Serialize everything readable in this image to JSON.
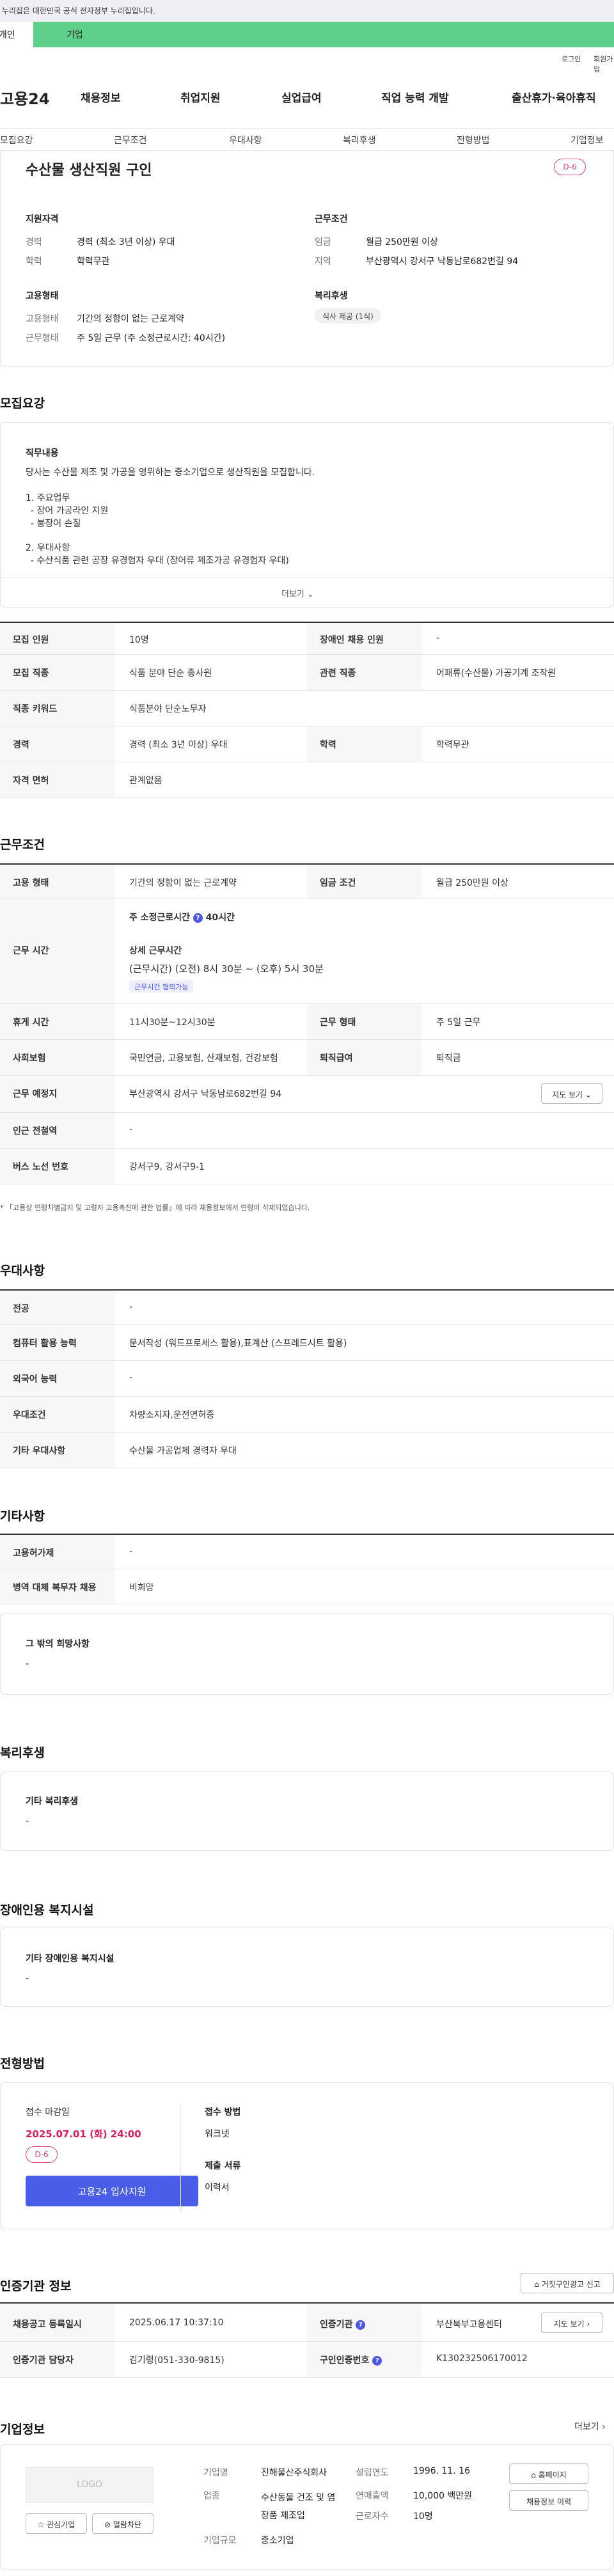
{
  "gov_banner": "이 누리집은 대한민국 공식 전자정부 누리집입니다.",
  "user_tabs": {
    "individual": "개인",
    "business": "기업"
  },
  "util_links": {
    "login": "로그인",
    "join": "회원가입"
  },
  "logo": "고용24",
  "gnb": [
    "채용정보",
    "취업지원",
    "실업급여",
    "직업 능력 개발",
    "출산휴가·육아휴직"
  ],
  "subnav": [
    "모집요강",
    "근무조건",
    "우대사항",
    "복리후생",
    "전형방법",
    "기업정보"
  ],
  "summary": {
    "title": "수산물 생산직원 구인",
    "dday": "D-6",
    "qualification": {
      "heading": "지원자격",
      "career_label": "경력",
      "career_value": "경력 (최소 3년 이상) 우대",
      "edu_label": "학력",
      "edu_value": "학력무관"
    },
    "condition": {
      "heading": "근무조건",
      "wage_label": "임금",
      "wage_value": "월급 250만원 이상",
      "region_label": "지역",
      "region_value": "부산광역시 강서구 낙동남로682번길 94"
    },
    "employment": {
      "heading": "고용형태",
      "type_label": "고용형태",
      "type_value": "기간의 정함이 없는 근로계약",
      "work_label": "근무형태",
      "work_value": "주 5일 근무 (주 소정근로시간: 40시간)"
    },
    "welfare": {
      "heading": "복리후생",
      "chip": "식사 제공 (1식)"
    }
  },
  "recruit": {
    "heading": "모집요강",
    "duty_heading": "직무내용",
    "lines": [
      "당사는 수산물 제조 및 가공을 영위하는 중소기업으로 생산직원을 모집합니다.",
      "1. 주요업무",
      "   - 장어 가공라인 지원",
      "   - 붕장어 손질",
      "2. 우대사항",
      "   - 수산식품 관련 공장 유경험자 우대 (장어류 제조가공 유경험자 우대)"
    ],
    "more": "더보기",
    "table": [
      {
        "l1": "모집 인원",
        "v1": "10명",
        "l2": "장애인 채용 인원",
        "v2": "-"
      },
      {
        "l1": "모집 직종",
        "v1": "식품 분야 단순 종사원",
        "l2": "관련 직종",
        "v2": "어패류(수산물) 가공기계 조작원"
      },
      {
        "l1": "직종 키워드",
        "v1": "식품분야 단순노무자",
        "l2": "",
        "v2": ""
      },
      {
        "l1": "경력",
        "v1": "경력 (최소 3년 이상) 우대",
        "l2": "학력",
        "v2": "학력무관"
      },
      {
        "l1": "자격 면허",
        "v1": "관계없음",
        "l2": "",
        "v2": ""
      }
    ]
  },
  "work": {
    "heading": "근무조건",
    "type_label": "고용 형태",
    "type_value": "기간의 정함이 없는 근로계약",
    "wage_label": "임금 조건",
    "wage_value": "월급 250만원 이상",
    "time_label": "근무 시간",
    "weekly_label": "주 소정근로시간",
    "weekly_value": "40시간",
    "detail_label": "상세 근무시간",
    "detail_value": "(근무시간) (오전) 8시 30분 ~ (오후) 5시 30분",
    "flex_chip": "근무시간 협의가능",
    "rest_label": "휴게 시간",
    "rest_value": "11시30분~12시30분",
    "form_label": "근무 형태",
    "form_value": "주 5일 근무",
    "insurance_label": "사회보험",
    "insurance_value": "국민연금, 고용보험, 산재보험, 건강보험",
    "severance_label": "퇴직급여",
    "severance_value": "퇴직금",
    "place_label": "근무 예정지",
    "place_value": "부산광역시 강서구 낙동남로682번길 94",
    "map_btn": "지도 보기",
    "subway_label": "인근 전철역",
    "subway_value": "-",
    "bus_label": "버스 노선 번호",
    "bus_value": "강서구9, 강서구9-1",
    "note": "「고용상 연령차별금지 및 고령자 고용촉진에 관한 법률」에 따라 채용정보에서 연령이 삭제되었습니다."
  },
  "preference": {
    "heading": "우대사항",
    "rows": [
      {
        "label": "전공",
        "value": "-"
      },
      {
        "label": "컴퓨터 활용 능력",
        "value": "문서작성 (워드프로세스 활용),표계산 (스프레드시트 활용)"
      },
      {
        "label": "외국어 능력",
        "value": "-"
      },
      {
        "label": "우대조건",
        "value": "차량소지자,운전면허증"
      },
      {
        "label": "기타 우대사항",
        "value": "수산물 가공업체 경력자 우대"
      }
    ]
  },
  "etc": {
    "heading": "기타사항",
    "rows": [
      {
        "label": "고용허가제",
        "value": "-"
      },
      {
        "label": "병역 대체 복무자 채용",
        "value": "비희망"
      }
    ],
    "box_title": "그 밖의 희망사항",
    "box_value": "-"
  },
  "benefit": {
    "heading": "복리후생",
    "box_title": "기타 복리후생",
    "box_value": "-"
  },
  "disability": {
    "heading": "장애인용 복지시설",
    "box_title": "기타 장애인용 복지시설",
    "box_value": "-"
  },
  "selection": {
    "heading": "전형방법",
    "deadline_label": "접수 마감일",
    "deadline_value": "2025.07.01 (화) 24:00",
    "dday": "D-6",
    "apply_btn": "고용24 입사지원",
    "method_label": "접수 방법",
    "method_value": "워크넷",
    "docs_label": "제출 서류",
    "docs_value": "이력서"
  },
  "agency": {
    "heading": "인증기관 정보",
    "report_btn": "거짓구인광고 신고",
    "reg_label": "채용공고 등록일시",
    "reg_value": "2025.06.17 10:37:10",
    "org_label": "인증기관",
    "org_value": "부산북부고용센터",
    "map_btn": "지도 보기",
    "manager_label": "인증기관 담당자",
    "manager_value": "김기령(051-330-9815)",
    "id_label": "구인인증번호",
    "id_value": "K130232506170012"
  },
  "company": {
    "heading": "기업정보",
    "more": "더보기",
    "logo_text": "LOGO",
    "interest_btn": "관심기업",
    "block_btn": "열람차단",
    "name_label": "기업명",
    "name_value": "진해물산주식회사",
    "industry_label": "업종",
    "industry_value": "수산동물 건조 및 염장품 제조업",
    "size_label": "기업규모",
    "size_value": "중소기업",
    "founded_label": "설립연도",
    "founded_value": "1996. 11. 16",
    "sales_label": "연매출액",
    "sales_value": "10,000 백만원",
    "staff_label": "근로자수",
    "staff_value": "10명",
    "homepage_btn": "홈페이지",
    "history_btn": "채용정보 이력"
  }
}
